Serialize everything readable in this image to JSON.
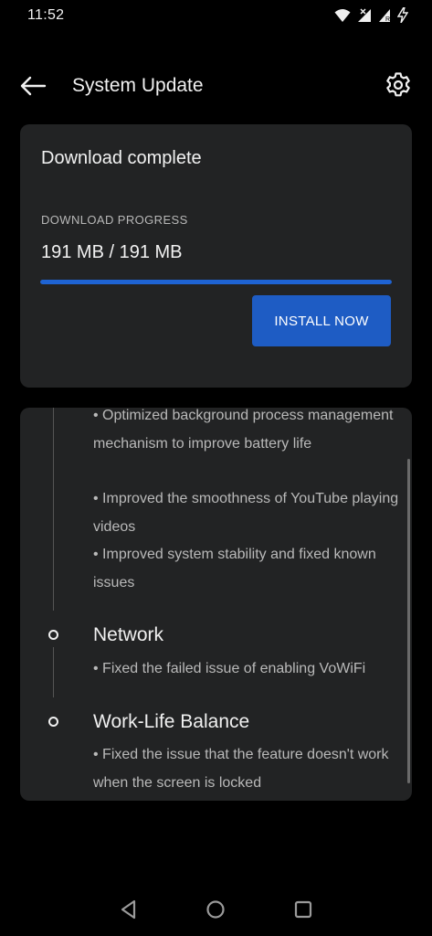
{
  "status_bar": {
    "time": "11:52",
    "icons": [
      "wifi-icon",
      "signal-icon",
      "no-sim-icon",
      "charging-icon"
    ]
  },
  "app_bar": {
    "title": "System Update",
    "back_icon": "arrow-left-icon",
    "settings_icon": "gear-icon"
  },
  "download": {
    "status": "Download complete",
    "progress_label": "DOWNLOAD PROGRESS",
    "progress_text": "191 MB / 191 MB",
    "progress_fraction": 1.0,
    "install_label": "INSTALL NOW"
  },
  "changelog": {
    "top_bullets": [
      "• Optimized background process management mechanism to improve battery life",
      "• Improved the smoothness of YouTube playing videos",
      "• Improved system stability and fixed known issues"
    ],
    "sections": [
      {
        "title": "Network",
        "bullets": [
          "• Fixed the failed issue of enabling VoWiFi"
        ]
      },
      {
        "title": "Work-Life Balance",
        "bullets": [
          "• Fixed the issue that the feature doesn't work when the screen is locked"
        ]
      }
    ]
  },
  "nav_bar": {
    "icons": [
      "back-triangle-icon",
      "home-circle-icon",
      "recents-square-icon"
    ]
  },
  "colors": {
    "background": "#000000",
    "card": "#222324",
    "accent": "#1e5cc4",
    "progress": "#1e63d3"
  }
}
